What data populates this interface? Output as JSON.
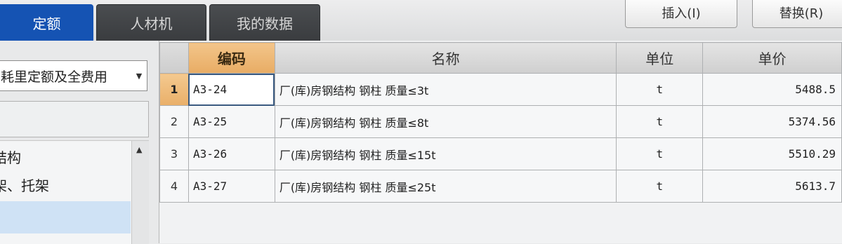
{
  "tabs": [
    {
      "label": "定额"
    },
    {
      "label": "人材机"
    },
    {
      "label": "我的数据"
    }
  ],
  "toolbar": {
    "insert_label": "插入(I)",
    "replace_label": "替换(R)"
  },
  "left_panel": {
    "dropdown_value": "耗里定额及全费用",
    "tree_items": [
      "结构",
      "架、托架"
    ]
  },
  "grid": {
    "headers": {
      "code": "编码",
      "name": "名称",
      "unit": "单位",
      "price": "单价"
    },
    "rows": [
      {
        "num": "1",
        "code": "A3-24",
        "name": "厂(库)房钢结构 钢柱 质量≤3t",
        "unit": "t",
        "price": "5488.5"
      },
      {
        "num": "2",
        "code": "A3-25",
        "name": "厂(库)房钢结构 钢柱 质量≤8t",
        "unit": "t",
        "price": "5374.56"
      },
      {
        "num": "3",
        "code": "A3-26",
        "name": "厂(库)房钢结构 钢柱 质量≤15t",
        "unit": "t",
        "price": "5510.29"
      },
      {
        "num": "4",
        "code": "A3-27",
        "name": "厂(库)房钢结构 钢柱 质量≤25t",
        "unit": "t",
        "price": "5613.7"
      }
    ]
  }
}
